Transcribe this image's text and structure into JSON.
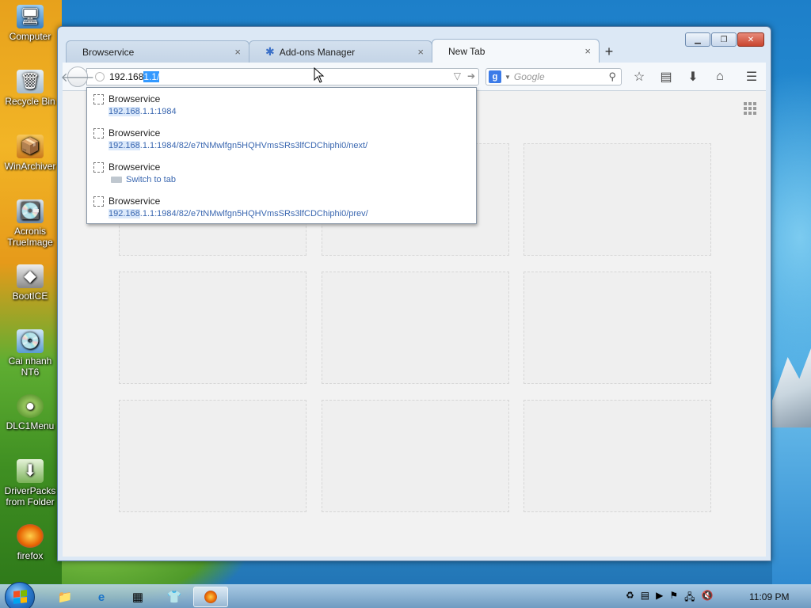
{
  "desktop": {
    "icons": [
      {
        "label": "Computer",
        "icon": "computer-icon"
      },
      {
        "label": "Recycle Bin",
        "icon": "recycle-bin-icon"
      },
      {
        "label": "WinArchiver",
        "icon": "archive-icon"
      },
      {
        "label": "Acronis TrueImage",
        "icon": "acronis-icon"
      },
      {
        "label": "BootICE",
        "icon": "bootice-icon"
      },
      {
        "label": "Cai nhanh NT6",
        "icon": "installer-icon"
      },
      {
        "label": "DLC1Menu",
        "icon": "dlc-icon"
      },
      {
        "label": "DriverPacks from Folder",
        "icon": "driverpacks-icon"
      },
      {
        "label": "firefox",
        "icon": "firefox-icon"
      }
    ]
  },
  "browser": {
    "tabs": [
      {
        "label": "Browservice",
        "close": "×"
      },
      {
        "label": "Add-ons Manager",
        "close": "×"
      },
      {
        "label": "New Tab",
        "close": "×"
      }
    ],
    "new_tab": "+",
    "urlbar": {
      "typed": "192.168",
      "selected": "1.1/"
    },
    "search": {
      "placeholder": "Google",
      "engine": "g"
    },
    "suggestions": [
      {
        "title": "Browservice",
        "url_hl": "192.168",
        "url_rest": ".1.1:1984"
      },
      {
        "title": "Browservice",
        "url_hl": "192.168",
        "url_rest": ".1.1:1984/82/e7tNMwlfgn5HQHVmsSRs3lfCDChiphi0/next/"
      },
      {
        "title": "Browservice",
        "action": "Switch to tab"
      },
      {
        "title": "Browservice",
        "url_hl": "192.168",
        "url_rest": ".1.1:1984/82/e7tNMwlfgn5HQHVmsSRs3lfCDChiphi0/prev/"
      }
    ]
  },
  "taskbar": {
    "clock": "11:09 PM"
  },
  "colors": {
    "accent": "#3399ff",
    "link": "#3a67b0"
  }
}
